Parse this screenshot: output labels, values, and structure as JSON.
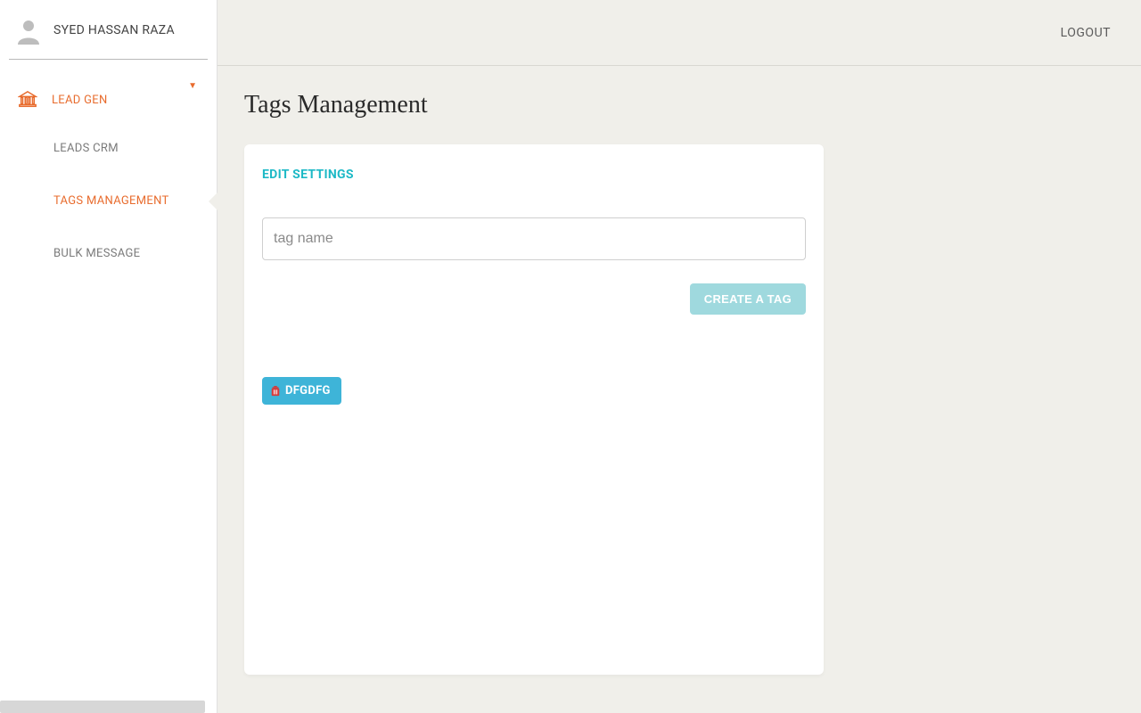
{
  "user": {
    "name": "SYED HASSAN RAZA"
  },
  "topbar": {
    "logout": "LOGOUT"
  },
  "sidebar": {
    "parent": {
      "label": "LEAD GEN"
    },
    "children": [
      {
        "label": "LEADS CRM",
        "active": false
      },
      {
        "label": "TAGS MANAGEMENT",
        "active": true
      },
      {
        "label": "BULK MESSAGE",
        "active": false
      }
    ]
  },
  "page": {
    "title": "Tags Management",
    "card_subtitle": "EDIT SETTINGS",
    "tag_placeholder": "tag name",
    "create_button": "CREATE A TAG",
    "tags": [
      {
        "label": "DFGDFG"
      }
    ]
  },
  "colors": {
    "accent_orange": "#e86c2e",
    "accent_teal": "#1db9c6",
    "button_teal_light": "#9fd9de",
    "chip_blue": "#3eb4d8"
  }
}
